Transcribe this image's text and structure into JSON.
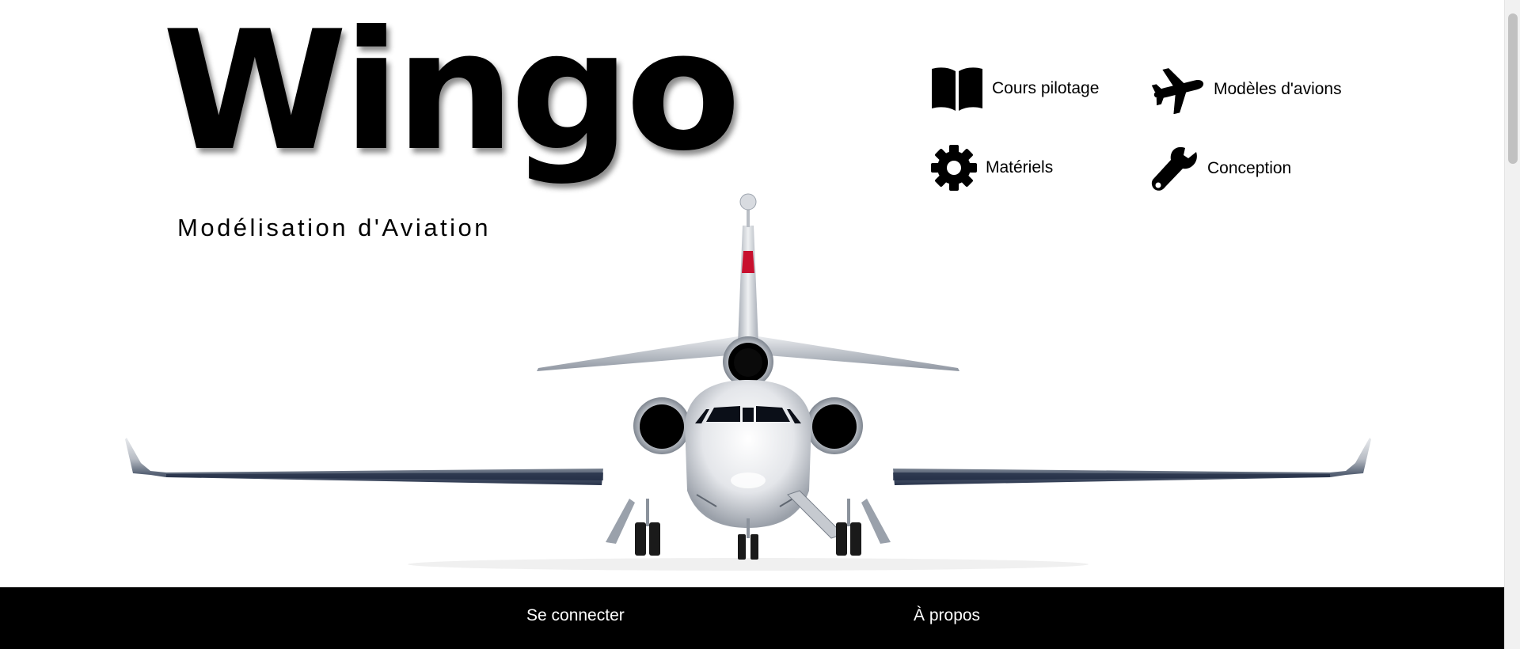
{
  "brand": {
    "logo_text": "Wingo",
    "tagline": "Modélisation d'Aviation"
  },
  "nav": {
    "items": [
      {
        "label": "Cours pilotage",
        "icon": "book-icon"
      },
      {
        "label": "Modèles d'avions",
        "icon": "airplane-icon"
      },
      {
        "label": "Matériels",
        "icon": "gear-icon"
      },
      {
        "label": "Conception",
        "icon": "wrench-icon"
      }
    ]
  },
  "footer": {
    "login_label": "Se connecter",
    "about_label": "À propos"
  },
  "colors": {
    "background": "#ffffff",
    "footer_background": "#000000",
    "footer_text": "#ffffff",
    "accent_tail": "#c8102e"
  }
}
